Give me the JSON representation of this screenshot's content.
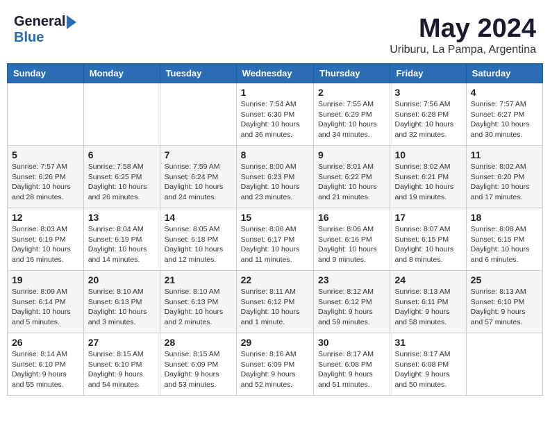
{
  "logo": {
    "general": "General",
    "blue": "Blue"
  },
  "title": "May 2024",
  "location": "Uriburu, La Pampa, Argentina",
  "weekdays": [
    "Sunday",
    "Monday",
    "Tuesday",
    "Wednesday",
    "Thursday",
    "Friday",
    "Saturday"
  ],
  "weeks": [
    [
      {
        "day": "",
        "info": ""
      },
      {
        "day": "",
        "info": ""
      },
      {
        "day": "",
        "info": ""
      },
      {
        "day": "1",
        "info": "Sunrise: 7:54 AM\nSunset: 6:30 PM\nDaylight: 10 hours\nand 36 minutes."
      },
      {
        "day": "2",
        "info": "Sunrise: 7:55 AM\nSunset: 6:29 PM\nDaylight: 10 hours\nand 34 minutes."
      },
      {
        "day": "3",
        "info": "Sunrise: 7:56 AM\nSunset: 6:28 PM\nDaylight: 10 hours\nand 32 minutes."
      },
      {
        "day": "4",
        "info": "Sunrise: 7:57 AM\nSunset: 6:27 PM\nDaylight: 10 hours\nand 30 minutes."
      }
    ],
    [
      {
        "day": "5",
        "info": "Sunrise: 7:57 AM\nSunset: 6:26 PM\nDaylight: 10 hours\nand 28 minutes."
      },
      {
        "day": "6",
        "info": "Sunrise: 7:58 AM\nSunset: 6:25 PM\nDaylight: 10 hours\nand 26 minutes."
      },
      {
        "day": "7",
        "info": "Sunrise: 7:59 AM\nSunset: 6:24 PM\nDaylight: 10 hours\nand 24 minutes."
      },
      {
        "day": "8",
        "info": "Sunrise: 8:00 AM\nSunset: 6:23 PM\nDaylight: 10 hours\nand 23 minutes."
      },
      {
        "day": "9",
        "info": "Sunrise: 8:01 AM\nSunset: 6:22 PM\nDaylight: 10 hours\nand 21 minutes."
      },
      {
        "day": "10",
        "info": "Sunrise: 8:02 AM\nSunset: 6:21 PM\nDaylight: 10 hours\nand 19 minutes."
      },
      {
        "day": "11",
        "info": "Sunrise: 8:02 AM\nSunset: 6:20 PM\nDaylight: 10 hours\nand 17 minutes."
      }
    ],
    [
      {
        "day": "12",
        "info": "Sunrise: 8:03 AM\nSunset: 6:19 PM\nDaylight: 10 hours\nand 16 minutes."
      },
      {
        "day": "13",
        "info": "Sunrise: 8:04 AM\nSunset: 6:19 PM\nDaylight: 10 hours\nand 14 minutes."
      },
      {
        "day": "14",
        "info": "Sunrise: 8:05 AM\nSunset: 6:18 PM\nDaylight: 10 hours\nand 12 minutes."
      },
      {
        "day": "15",
        "info": "Sunrise: 8:06 AM\nSunset: 6:17 PM\nDaylight: 10 hours\nand 11 minutes."
      },
      {
        "day": "16",
        "info": "Sunrise: 8:06 AM\nSunset: 6:16 PM\nDaylight: 10 hours\nand 9 minutes."
      },
      {
        "day": "17",
        "info": "Sunrise: 8:07 AM\nSunset: 6:15 PM\nDaylight: 10 hours\nand 8 minutes."
      },
      {
        "day": "18",
        "info": "Sunrise: 8:08 AM\nSunset: 6:15 PM\nDaylight: 10 hours\nand 6 minutes."
      }
    ],
    [
      {
        "day": "19",
        "info": "Sunrise: 8:09 AM\nSunset: 6:14 PM\nDaylight: 10 hours\nand 5 minutes."
      },
      {
        "day": "20",
        "info": "Sunrise: 8:10 AM\nSunset: 6:13 PM\nDaylight: 10 hours\nand 3 minutes."
      },
      {
        "day": "21",
        "info": "Sunrise: 8:10 AM\nSunset: 6:13 PM\nDaylight: 10 hours\nand 2 minutes."
      },
      {
        "day": "22",
        "info": "Sunrise: 8:11 AM\nSunset: 6:12 PM\nDaylight: 10 hours\nand 1 minute."
      },
      {
        "day": "23",
        "info": "Sunrise: 8:12 AM\nSunset: 6:12 PM\nDaylight: 9 hours\nand 59 minutes."
      },
      {
        "day": "24",
        "info": "Sunrise: 8:13 AM\nSunset: 6:11 PM\nDaylight: 9 hours\nand 58 minutes."
      },
      {
        "day": "25",
        "info": "Sunrise: 8:13 AM\nSunset: 6:10 PM\nDaylight: 9 hours\nand 57 minutes."
      }
    ],
    [
      {
        "day": "26",
        "info": "Sunrise: 8:14 AM\nSunset: 6:10 PM\nDaylight: 9 hours\nand 55 minutes."
      },
      {
        "day": "27",
        "info": "Sunrise: 8:15 AM\nSunset: 6:10 PM\nDaylight: 9 hours\nand 54 minutes."
      },
      {
        "day": "28",
        "info": "Sunrise: 8:15 AM\nSunset: 6:09 PM\nDaylight: 9 hours\nand 53 minutes."
      },
      {
        "day": "29",
        "info": "Sunrise: 8:16 AM\nSunset: 6:09 PM\nDaylight: 9 hours\nand 52 minutes."
      },
      {
        "day": "30",
        "info": "Sunrise: 8:17 AM\nSunset: 6:08 PM\nDaylight: 9 hours\nand 51 minutes."
      },
      {
        "day": "31",
        "info": "Sunrise: 8:17 AM\nSunset: 6:08 PM\nDaylight: 9 hours\nand 50 minutes."
      },
      {
        "day": "",
        "info": ""
      }
    ]
  ]
}
